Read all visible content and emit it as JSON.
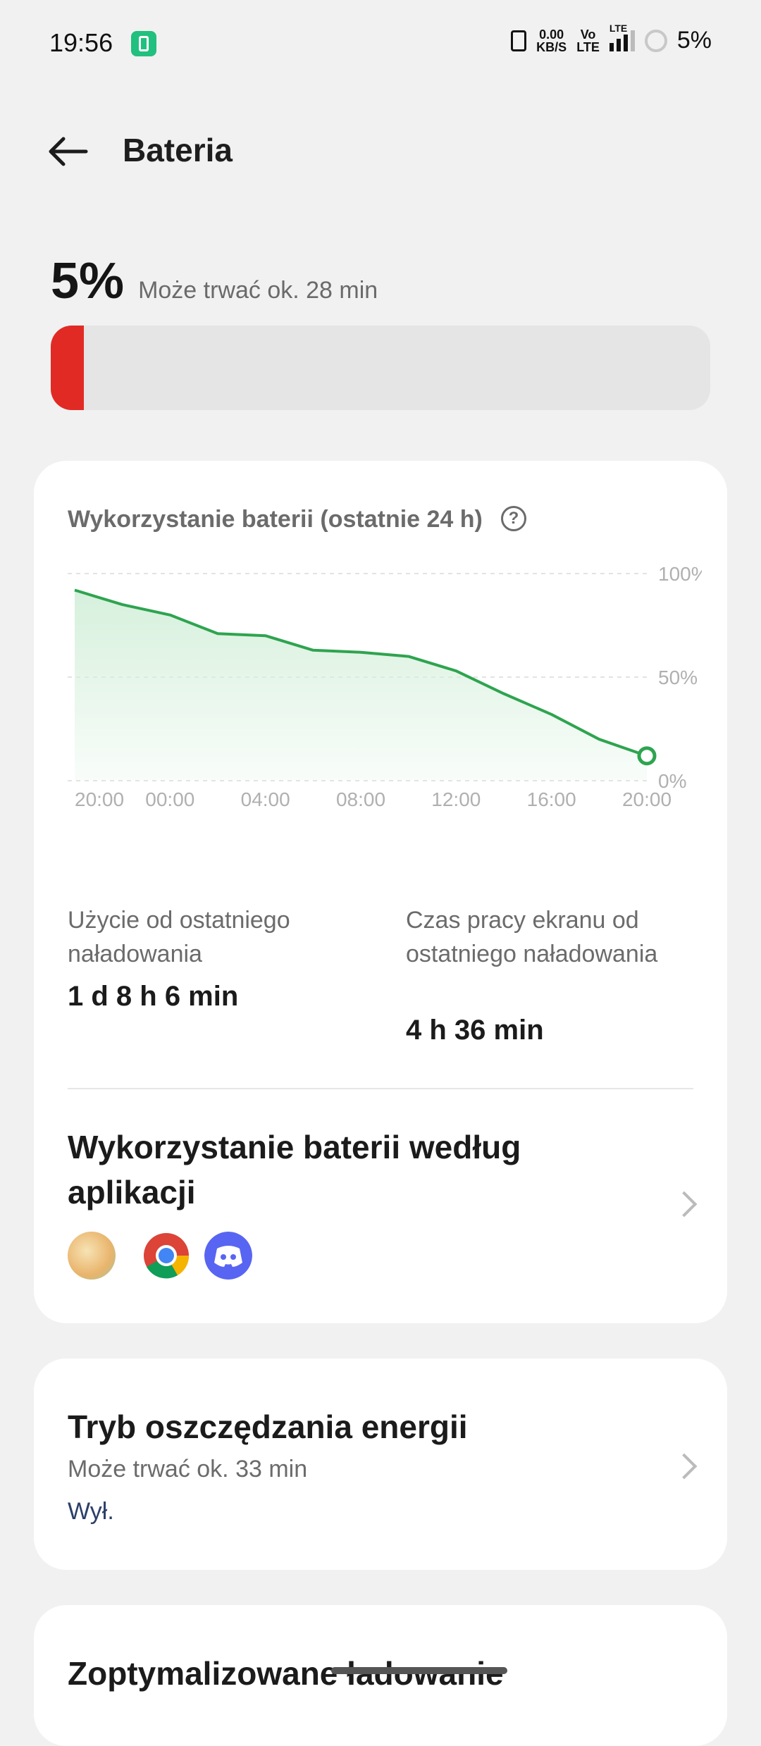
{
  "status_bar": {
    "time": "19:56",
    "net_speed_value": "0.00",
    "net_speed_unit": "KB/S",
    "volte_top": "Vo",
    "volte_bottom": "LTE",
    "lte_label": "LTE",
    "battery_percent": "5%"
  },
  "header": {
    "title": "Bateria"
  },
  "battery": {
    "level_text": "5%",
    "level_fraction": 0.05,
    "estimate": "Może trwać ok. 28 min",
    "bar_color": "#e22a24"
  },
  "usage_card": {
    "title": "Wykorzystanie baterii (ostatnie 24 h)",
    "help_symbol": "?",
    "chart_data": {
      "type": "area",
      "x": [
        "20:00",
        "22:00",
        "00:00",
        "02:00",
        "04:00",
        "06:00",
        "08:00",
        "10:00",
        "12:00",
        "14:00",
        "16:00",
        "18:00",
        "20:00"
      ],
      "values": [
        92,
        85,
        80,
        71,
        70,
        63,
        62,
        60,
        53,
        42,
        32,
        20,
        12
      ],
      "x_tick_labels": [
        "20:00",
        "00:00",
        "04:00",
        "08:00",
        "12:00",
        "16:00",
        "20:00"
      ],
      "y_tick_labels": [
        "100%",
        "50%",
        "0%"
      ],
      "ylim": [
        0,
        100
      ],
      "grid": true,
      "line_color": "#2ea44f",
      "fill_color": "#d6f0dc"
    },
    "since_charge_label": "Użycie od ostatniego naładowania",
    "since_charge_value": "1 d 8 h 6 min",
    "screen_time_label": "Czas pracy ekranu od ostatniego naładowania",
    "screen_time_value": "4 h 36 min",
    "apps_title": "Wykorzystanie baterii według aplikacji",
    "apps": [
      {
        "name": "game-app-icon",
        "color": "#f4d28c"
      },
      {
        "name": "chrome-icon",
        "color": "#db4437"
      },
      {
        "name": "discord-icon",
        "color": "#5865f2"
      }
    ]
  },
  "power_saving_card": {
    "title": "Tryb oszczędzania energii",
    "estimate": "Może trwać ok. 33 min",
    "state": "Wył."
  },
  "optimized_card": {
    "title": "Zoptymalizowane ładowanie"
  }
}
